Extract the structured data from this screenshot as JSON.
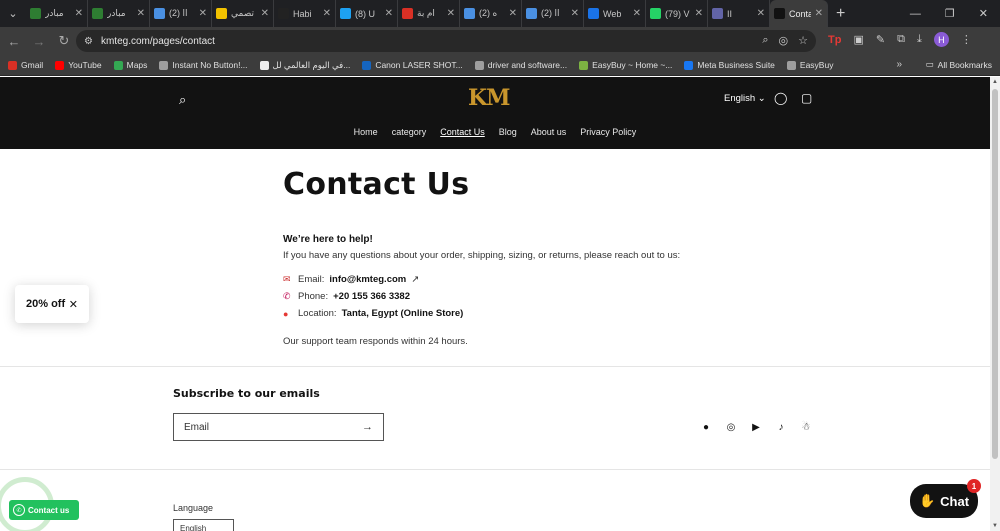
{
  "browser": {
    "tabs": [
      {
        "title": "مبادر",
        "color": "#2e7d32"
      },
      {
        "title": "مبادر",
        "color": "#2e7d32"
      },
      {
        "title": "(2) اا",
        "color": "#4a90e2"
      },
      {
        "title": "تصمي",
        "color": "#f2c200"
      },
      {
        "title": "Habi",
        "color": "#222222"
      },
      {
        "title": "(8) U",
        "color": "#1da1f2"
      },
      {
        "title": "ام بة",
        "color": "#d93025"
      },
      {
        "title": "(2) ه",
        "color": "#4a90e2"
      },
      {
        "title": "(2) اا",
        "color": "#4a90e2"
      },
      {
        "title": "Web",
        "color": "#1a73e8"
      },
      {
        "title": "(79) V",
        "color": "#25d366"
      },
      {
        "title": "II",
        "color": "#6264a7"
      },
      {
        "title": "Conta",
        "color": "#121212"
      }
    ],
    "url": "kmteg.com/pages/contact",
    "profile_initial": "H",
    "bookmarks": [
      {
        "label": "Gmail",
        "color": "#d93025"
      },
      {
        "label": "YouTube",
        "color": "#ff0000"
      },
      {
        "label": "Maps",
        "color": "#34a853"
      },
      {
        "label": "Instant No Button!...",
        "color": "#9e9e9e"
      },
      {
        "label": "في اليوم العالمي لل...",
        "color": "#eeeeee"
      },
      {
        "label": "Canon LASER SHOT...",
        "color": "#1565c0"
      },
      {
        "label": "driver and software...",
        "color": "#9e9e9e"
      },
      {
        "label": "EasyBuy ~ Home ~...",
        "color": "#7cb342"
      },
      {
        "label": "Meta Business Suite",
        "color": "#1877f2"
      },
      {
        "label": "EasyBuy",
        "color": "#9e9e9e"
      }
    ],
    "all_bookmarks": "All Bookmarks"
  },
  "header": {
    "logo": "KM",
    "language": "English",
    "nav": [
      "Home",
      "category",
      "Contact Us",
      "Blog",
      "About us",
      "Privacy Policy"
    ]
  },
  "contact": {
    "title": "Contact Us",
    "help": "We’re here to help!",
    "intro": "If you have any questions about your order, shipping, sizing, or returns, please reach out to us:",
    "email_label": "Email:",
    "email_value": "info@kmteg.com",
    "phone_label": "Phone:",
    "phone_value": "+20 155 366 3382",
    "location_label": "Location:",
    "location_value": "Tanta, Egypt (Online Store)",
    "note": "Our support team responds within 24 hours."
  },
  "subscribe": {
    "title": "Subscribe to our emails",
    "placeholder": "Email"
  },
  "footer": {
    "language_label": "Language",
    "language_value": "English"
  },
  "popup": {
    "label": "20% off"
  },
  "whatsapp": {
    "label": "Contact us"
  },
  "chat": {
    "label": "Chat",
    "badge": "1"
  }
}
